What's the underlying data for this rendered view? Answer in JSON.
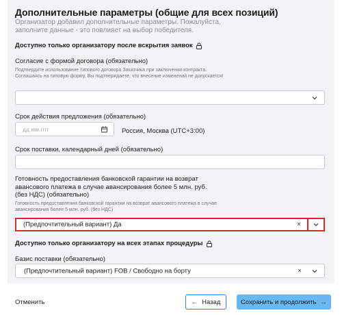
{
  "header": {
    "title": "Дополнительные параметры (общие для всех позиций)",
    "subtitle": "Организатор добавил дополнительные параметры. Пожалуйста, заполните данные - это повлияет на выбор победителя."
  },
  "section_after_opening": {
    "heading": "Доступно только организатору после вскрытия заявок",
    "icon": "lock-icon"
  },
  "contract_agreement": {
    "label": "Согласие с формой договора (обязательно)",
    "hint": "Подтвердите использование типового договора Заказчика при заключении контракта. Соглашаясь на типовую форму, Вы подтверждаете, что внесение изменений не допускается!",
    "value": ""
  },
  "offer_validity": {
    "label": "Срок действия предложения (обязательно)",
    "placeholder": "дд.мм.гггг",
    "timezone": "Россия, Москва (UTC+3:00)"
  },
  "delivery_term": {
    "label": "Срок поставки, календарный дней (обязательно)",
    "value": ""
  },
  "bank_guarantee": {
    "label": "Готовность предоставления банковской гарантии на возврат авансового платежа в случае авансирования более 5 млн. руб. (без НДС) (обязательно)",
    "hint": "Готовность предоставления банковской гарантии на возврат авансового платежа в случае авансирования более 5 млн. руб. (без НДС)",
    "value": "(Предпочтительный вариант) Да",
    "clear_glyph": "×"
  },
  "section_all_stages": {
    "heading": "Доступно только организатору на всех этапах процедуры",
    "icon": "lock-icon"
  },
  "delivery_basis": {
    "label": "Базис поставки (обязательно)",
    "value": "(Предпочтительный вариант) FOB / Свободно на борту",
    "clear_glyph": "×"
  },
  "footer": {
    "cancel_label": "Отменить",
    "back_label": "Назад",
    "back_arrow": "←",
    "save_label": "Сохранить и продолжить",
    "save_arrow": "→"
  },
  "colors": {
    "panel_bg": "#f2f3f5",
    "highlight": "#d62b2b",
    "primary_button": "#69b8f1",
    "back_border": "#2f80ed"
  }
}
